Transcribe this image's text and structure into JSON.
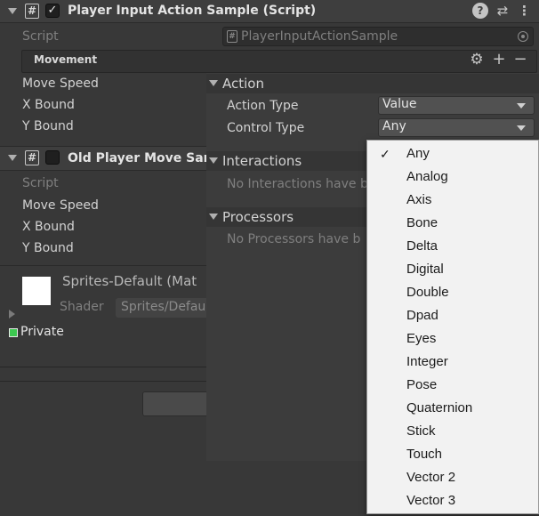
{
  "component1": {
    "title": "Player Input Action Sample (Script)",
    "enabled": true,
    "script_label": "Script",
    "script_value": "PlayerInputActionSample",
    "movement_header": "Movement",
    "fields": [
      "Move Speed",
      "X Bound",
      "Y Bound"
    ]
  },
  "action_panel": {
    "action_header": "Action",
    "action_type_label": "Action Type",
    "action_type_value": "Value",
    "control_type_label": "Control Type",
    "control_type_value": "Any",
    "interactions_header": "Interactions",
    "interactions_empty": "No Interactions have b",
    "processors_header": "Processors",
    "processors_empty": "No Processors have b"
  },
  "component2": {
    "title": "Old Player Move Sam",
    "enabled": false,
    "script_label": "Script",
    "fields": [
      "Move Speed",
      "X Bound",
      "Y Bound"
    ]
  },
  "material": {
    "name": "Sprites-Default (Mat",
    "shader_label": "Shader",
    "shader_value": "Sprites/Defau",
    "private_label": "Private"
  },
  "control_type_dropdown": {
    "selected": "Any",
    "options": [
      "Any",
      "Analog",
      "Axis",
      "Bone",
      "Delta",
      "Digital",
      "Double",
      "Dpad",
      "Eyes",
      "Integer",
      "Pose",
      "Quaternion",
      "Stick",
      "Touch",
      "Vector 2",
      "Vector 3"
    ]
  },
  "icons": {
    "help": "help-icon",
    "presets": "presets-icon",
    "menu": "kebab-menu-icon",
    "gear": "gear-icon",
    "add": "add-icon",
    "remove": "remove-icon",
    "target": "object-picker-icon"
  },
  "colors": {
    "background": "#383838",
    "panel": "#3c3c3c",
    "menu_background": "#f2f2f2",
    "private_badge": "#3cc850"
  }
}
